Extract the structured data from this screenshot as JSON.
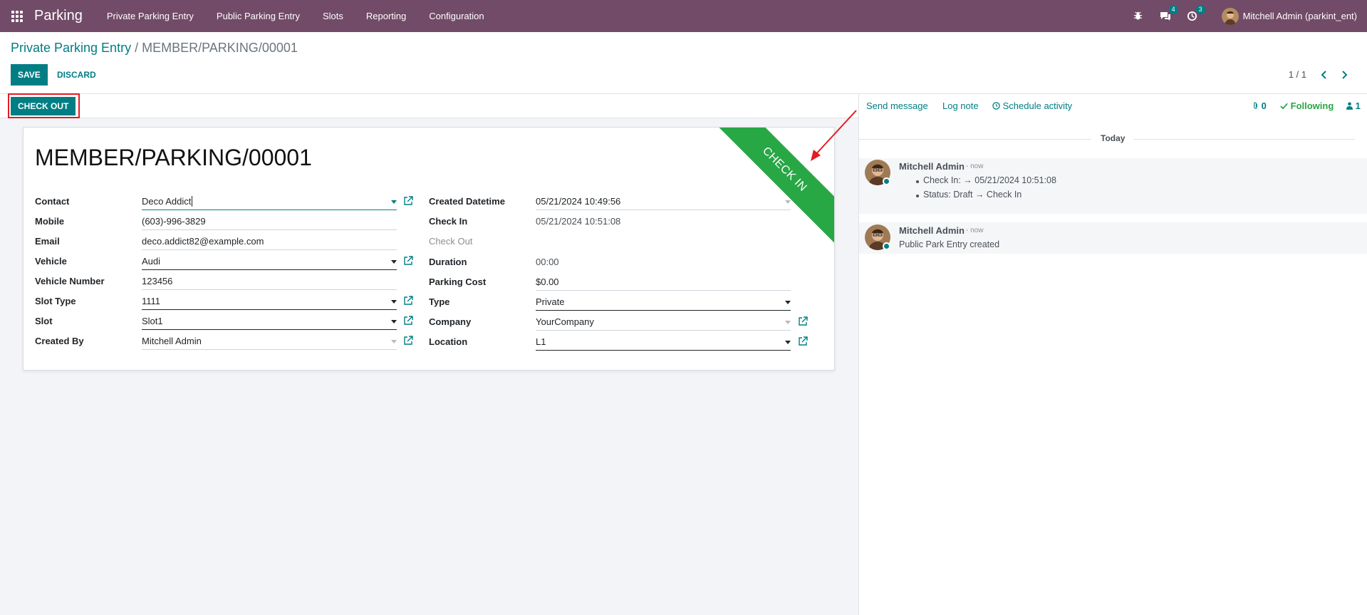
{
  "app": {
    "brand": "Parking",
    "menu": [
      "Private Parking Entry",
      "Public Parking Entry",
      "Slots",
      "Reporting",
      "Configuration"
    ],
    "messages_badge": "4",
    "activities_badge": "3",
    "user": "Mitchell Admin (parkint_ent)"
  },
  "breadcrumb": {
    "parent": "Private Parking Entry",
    "separator": "/",
    "current": "MEMBER/PARKING/00001"
  },
  "buttons": {
    "save": "SAVE",
    "discard": "DISCARD",
    "check_out": "CHECK OUT"
  },
  "pager": "1 / 1",
  "record": {
    "title": "MEMBER/PARKING/00001",
    "ribbon": "CHECK IN",
    "left": {
      "contact_label": "Contact",
      "contact": "Deco Addict",
      "mobile_label": "Mobile",
      "mobile": "(603)-996-3829",
      "email_label": "Email",
      "email": "deco.addict82@example.com",
      "vehicle_label": "Vehicle",
      "vehicle": "Audi",
      "vehicle_number_label": "Vehicle Number",
      "vehicle_number": "123456",
      "slot_type_label": "Slot Type",
      "slot_type": "1111",
      "slot_label": "Slot",
      "slot": "Slot1",
      "created_by_label": "Created By",
      "created_by": "Mitchell Admin"
    },
    "right": {
      "created_datetime_label": "Created Datetime",
      "created_datetime": "05/21/2024 10:49:56",
      "check_in_label": "Check In",
      "check_in": "05/21/2024 10:51:08",
      "check_out_label": "Check Out",
      "duration_label": "Duration",
      "duration": "00:00",
      "parking_cost_label": "Parking Cost",
      "parking_cost": "$0.00",
      "type_label": "Type",
      "type": "Private",
      "company_label": "Company",
      "company": "YourCompany",
      "location_label": "Location",
      "location": "L1"
    }
  },
  "chatter": {
    "send_message": "Send message",
    "log_note": "Log note",
    "schedule_activity": "Schedule activity",
    "attachments": "0",
    "following": "Following",
    "followers": "1",
    "today": "Today",
    "messages": [
      {
        "author": "Mitchell Admin",
        "time": "- now",
        "lines": [
          "Check In: → 05/21/2024 10:51:08",
          "Status: Draft → Check In"
        ]
      },
      {
        "author": "Mitchell Admin",
        "time": "- now",
        "text": "Public Park Entry created"
      }
    ]
  },
  "colors": {
    "topbar": "#714B67",
    "primary": "#017e84",
    "ribbon": "#28a745",
    "highlight": "#e31b23"
  }
}
